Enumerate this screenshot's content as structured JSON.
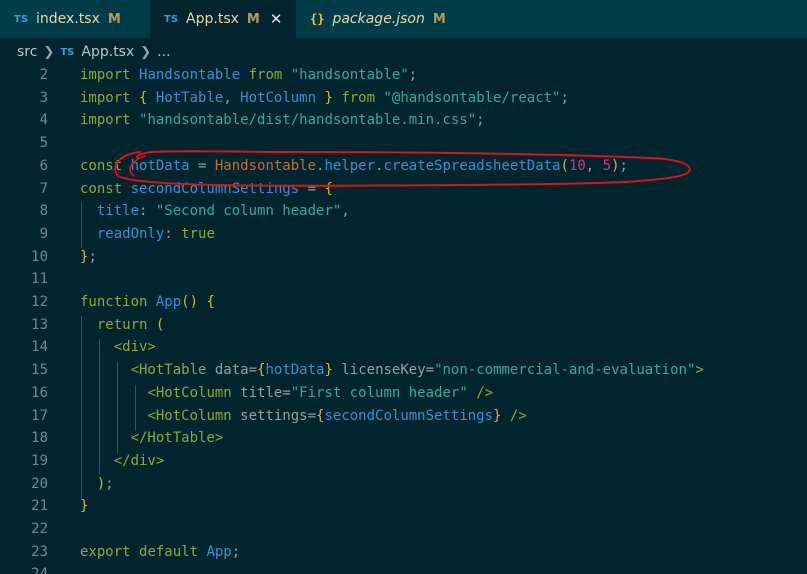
{
  "tabs": [
    {
      "icon": "TS",
      "title": "index.tsx",
      "modified": "M",
      "active": false,
      "italic": false,
      "close": ""
    },
    {
      "icon": "TS",
      "title": "App.tsx",
      "modified": "M",
      "active": true,
      "italic": false,
      "close": "✕"
    },
    {
      "icon": "{}",
      "title": "package.json",
      "modified": "M",
      "active": false,
      "italic": true,
      "close": ""
    }
  ],
  "breadcrumb": {
    "folder": "src",
    "file_icon": "TS",
    "file": "App.tsx",
    "more": "..."
  },
  "editor": {
    "lines": [
      {
        "n": "2",
        "segs": [
          [
            "kw",
            "import "
          ],
          [
            "id",
            "Handsontable "
          ],
          [
            "kw",
            "from "
          ],
          [
            "str",
            "\"handsontable\""
          ],
          [
            "plain",
            ";"
          ]
        ]
      },
      {
        "n": "3",
        "segs": [
          [
            "kw",
            "import "
          ],
          [
            "br",
            "{ "
          ],
          [
            "id",
            "HotTable"
          ],
          [
            "plain",
            ", "
          ],
          [
            "id",
            "HotColumn "
          ],
          [
            "br",
            "} "
          ],
          [
            "kw",
            "from "
          ],
          [
            "str",
            "\"@handsontable/react\""
          ],
          [
            "plain",
            ";"
          ]
        ]
      },
      {
        "n": "4",
        "segs": [
          [
            "kw",
            "import "
          ],
          [
            "str",
            "\"handsontable/dist/handsontable.min.css\""
          ],
          [
            "plain",
            ";"
          ]
        ]
      },
      {
        "n": "5",
        "segs": []
      },
      {
        "n": "6",
        "segs": [
          [
            "kw",
            "const "
          ],
          [
            "id",
            "hotData "
          ],
          [
            "plain",
            "= "
          ],
          [
            "cls",
            "Handsontable"
          ],
          [
            "plain",
            "."
          ],
          [
            "id",
            "helper"
          ],
          [
            "plain",
            "."
          ],
          [
            "fn",
            "createSpreadsheetData"
          ],
          [
            "br",
            "("
          ],
          [
            "num",
            "10"
          ],
          [
            "plain",
            ", "
          ],
          [
            "num",
            "5"
          ],
          [
            "br",
            ")"
          ],
          [
            "plain",
            ";"
          ]
        ]
      },
      {
        "n": "7",
        "segs": [
          [
            "kw",
            "const "
          ],
          [
            "id",
            "secondColumnSettings "
          ],
          [
            "plain",
            "= "
          ],
          [
            "br",
            "{"
          ]
        ]
      },
      {
        "n": "8",
        "segs": [
          [
            "plain",
            "  "
          ],
          [
            "id",
            "title"
          ],
          [
            "plain",
            ": "
          ],
          [
            "str",
            "\"Second column header\""
          ],
          [
            "plain",
            ","
          ]
        ]
      },
      {
        "n": "9",
        "segs": [
          [
            "plain",
            "  "
          ],
          [
            "id",
            "readOnly"
          ],
          [
            "plain",
            ": "
          ],
          [
            "kw",
            "true"
          ]
        ]
      },
      {
        "n": "10",
        "segs": [
          [
            "br",
            "}"
          ],
          [
            "plain",
            ";"
          ]
        ]
      },
      {
        "n": "11",
        "segs": []
      },
      {
        "n": "12",
        "segs": [
          [
            "kw",
            "function "
          ],
          [
            "fn",
            "App"
          ],
          [
            "br",
            "() {"
          ]
        ]
      },
      {
        "n": "13",
        "segs": [
          [
            "plain",
            "  "
          ],
          [
            "kw",
            "return "
          ],
          [
            "br",
            "("
          ]
        ]
      },
      {
        "n": "14",
        "segs": [
          [
            "plain",
            "    "
          ],
          [
            "tag",
            "<div>"
          ]
        ]
      },
      {
        "n": "15",
        "segs": [
          [
            "plain",
            "      "
          ],
          [
            "tag",
            "<HotTable "
          ],
          [
            "attr",
            "data"
          ],
          [
            "plain",
            "="
          ],
          [
            "br",
            "{"
          ],
          [
            "id",
            "hotData"
          ],
          [
            "br",
            "}"
          ],
          [
            "attr",
            " licenseKey"
          ],
          [
            "plain",
            "="
          ],
          [
            "str",
            "\"non-commercial-and-evaluation\""
          ],
          [
            "tag",
            ">"
          ]
        ]
      },
      {
        "n": "16",
        "segs": [
          [
            "plain",
            "        "
          ],
          [
            "tag",
            "<HotColumn "
          ],
          [
            "attr",
            "title"
          ],
          [
            "plain",
            "="
          ],
          [
            "str",
            "\"First column header\""
          ],
          [
            "tag",
            " />"
          ]
        ]
      },
      {
        "n": "17",
        "segs": [
          [
            "plain",
            "        "
          ],
          [
            "tag",
            "<HotColumn "
          ],
          [
            "attr",
            "settings"
          ],
          [
            "plain",
            "="
          ],
          [
            "br",
            "{"
          ],
          [
            "id",
            "secondColumnSettings"
          ],
          [
            "br",
            "}"
          ],
          [
            "tag",
            " />"
          ]
        ]
      },
      {
        "n": "18",
        "segs": [
          [
            "plain",
            "      "
          ],
          [
            "tag",
            "</HotTable>"
          ]
        ]
      },
      {
        "n": "19",
        "segs": [
          [
            "plain",
            "    "
          ],
          [
            "tag",
            "</div>"
          ]
        ]
      },
      {
        "n": "20",
        "segs": [
          [
            "plain",
            "  "
          ],
          [
            "br",
            ")"
          ],
          [
            "plain",
            ";"
          ]
        ]
      },
      {
        "n": "21",
        "segs": [
          [
            "br",
            "}"
          ]
        ]
      },
      {
        "n": "22",
        "segs": []
      },
      {
        "n": "23",
        "segs": [
          [
            "kw",
            "export "
          ],
          [
            "kw",
            "default "
          ],
          [
            "id",
            "App"
          ],
          [
            "plain",
            ";"
          ]
        ]
      },
      {
        "n": "24",
        "segs": []
      }
    ]
  },
  "colors": {
    "background": "#00252e",
    "tabbar": "#003b48",
    "annotation": "#e0101a"
  },
  "icons": {
    "ts": "typescript-file-icon",
    "json": "json-file-icon",
    "close": "close-icon",
    "chevron": "chevron-right-icon"
  }
}
